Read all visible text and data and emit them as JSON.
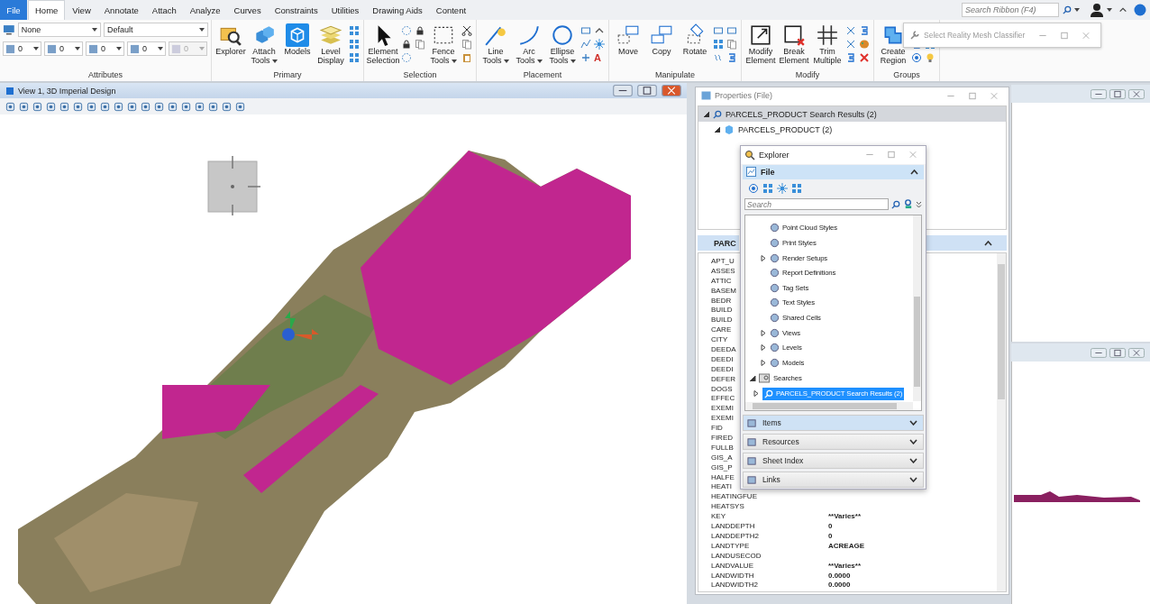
{
  "menu_tabs": [
    {
      "label": "File",
      "kind": "file",
      "selected": false
    },
    {
      "label": "Home",
      "kind": "tab",
      "selected": true
    },
    {
      "label": "View",
      "kind": "tab",
      "selected": false
    },
    {
      "label": "Annotate",
      "kind": "tab",
      "selected": false
    },
    {
      "label": "Attach",
      "kind": "tab",
      "selected": false
    },
    {
      "label": "Analyze",
      "kind": "tab",
      "selected": false
    },
    {
      "label": "Curves",
      "kind": "tab",
      "selected": false
    },
    {
      "label": "Constraints",
      "kind": "tab",
      "selected": false
    },
    {
      "label": "Utilities",
      "kind": "tab",
      "selected": false
    },
    {
      "label": "Drawing Aids",
      "kind": "tab",
      "selected": false
    },
    {
      "label": "Content",
      "kind": "tab",
      "selected": false
    }
  ],
  "ribbon_search": {
    "placeholder": "Search Ribbon (F4)"
  },
  "ribbon_groups": [
    {
      "title": "Attributes",
      "kind": "attributes",
      "dropdowns": [
        {
          "value": "None"
        },
        {
          "value": "Default"
        }
      ],
      "fields": [
        {
          "value": "0",
          "disabled": false
        },
        {
          "value": "0",
          "disabled": false
        },
        {
          "value": "0",
          "disabled": false
        },
        {
          "value": "0",
          "disabled": false
        },
        {
          "value": "0",
          "disabled": true
        }
      ]
    },
    {
      "title": "Primary",
      "kind": "tools",
      "tools": [
        {
          "label": "Explorer",
          "dropdown": false,
          "selected": false
        },
        {
          "label": "Attach Tools",
          "dropdown": true,
          "selected": false
        },
        {
          "label": "Models",
          "dropdown": false,
          "selected": true
        },
        {
          "label": "Level Display",
          "dropdown": false,
          "selected": false
        }
      ]
    },
    {
      "title": "Selection",
      "kind": "tools",
      "tools": [
        {
          "label": "Element Selection",
          "dropdown": false,
          "selected": false
        },
        {
          "label": "Fence Tools",
          "dropdown": true,
          "selected": false
        }
      ]
    },
    {
      "title": "Placement",
      "kind": "tools",
      "tools": [
        {
          "label": "Line Tools",
          "dropdown": true,
          "selected": false
        },
        {
          "label": "Arc Tools",
          "dropdown": true,
          "selected": false
        },
        {
          "label": "Ellipse Tools",
          "dropdown": true,
          "selected": false
        }
      ],
      "glyph": "A"
    },
    {
      "title": "Manipulate",
      "kind": "tools",
      "tools": [
        {
          "label": "Move",
          "dropdown": false,
          "selected": false
        },
        {
          "label": "Copy",
          "dropdown": false,
          "selected": false
        },
        {
          "label": "Rotate",
          "dropdown": false,
          "selected": false
        }
      ]
    },
    {
      "title": "Modify",
      "kind": "tools",
      "tools": [
        {
          "label": "Modify Element",
          "dropdown": false,
          "selected": false
        },
        {
          "label": "Break Element",
          "dropdown": false,
          "selected": false
        },
        {
          "label": "Trim Multiple",
          "dropdown": false,
          "selected": false
        }
      ]
    },
    {
      "title": "Groups",
      "kind": "tools",
      "tools": [
        {
          "label": "Create Region",
          "dropdown": false,
          "selected": false
        }
      ]
    }
  ],
  "floating_dialog": {
    "title": "Select Reality Mesh Classifier"
  },
  "view_window": {
    "title": "View 1, 3D Imperial Design"
  },
  "properties": {
    "title": "Properties (File)",
    "tree": [
      {
        "label": "PARCELS_PRODUCT Search Results (2)",
        "selected": true,
        "expanded": true,
        "children": [
          {
            "label": "PARCELS_PRODUCT (2)",
            "selected": false,
            "expanded": true
          }
        ]
      }
    ],
    "section": {
      "label": "PARC",
      "expanded": true
    },
    "rows": [
      {
        "name": "APT_U"
      },
      {
        "name": "ASSES"
      },
      {
        "name": "ATTIC"
      },
      {
        "name": "BASEM"
      },
      {
        "name": "BEDR"
      },
      {
        "name": "BUILD"
      },
      {
        "name": "BUILD"
      },
      {
        "name": "CARE"
      },
      {
        "name": "CITY"
      },
      {
        "name": "DEEDA"
      },
      {
        "name": "DEEDI"
      },
      {
        "name": "DEEDI"
      },
      {
        "name": "DEFER"
      },
      {
        "name": "DOGS"
      },
      {
        "name": "EFFEC"
      },
      {
        "name": "EXEMI"
      },
      {
        "name": "EXEMI"
      },
      {
        "name": "FID"
      },
      {
        "name": "FIRED"
      },
      {
        "name": "FULLB"
      },
      {
        "name": "GIS_A"
      },
      {
        "name": "GIS_P"
      },
      {
        "name": "HALFE"
      },
      {
        "name": "HEATI"
      },
      {
        "name": "HEATINGFUE"
      },
      {
        "name": "HEATSYS"
      },
      {
        "name": "KEY",
        "value": "**Varies**"
      },
      {
        "name": "LANDDEPTH",
        "value": "0"
      },
      {
        "name": "LANDDEPTH2",
        "value": "0"
      },
      {
        "name": "LANDTYPE",
        "value": "ACREAGE"
      },
      {
        "name": "LANDUSECOD"
      },
      {
        "name": "LANDVALUE",
        "value": "**Varies**"
      },
      {
        "name": "LANDWIDTH",
        "value": "0.0000"
      },
      {
        "name": "LANDWIDTH2",
        "value": "0.0000"
      }
    ]
  },
  "explorer": {
    "title": "Explorer",
    "file_section": {
      "label": "File",
      "expanded": true
    },
    "search": {
      "placeholder": "Search"
    },
    "tree_upper": [
      {
        "label": "Point Cloud Styles"
      },
      {
        "label": "Print Styles"
      },
      {
        "label": "Render Setups",
        "expanded": false
      },
      {
        "label": "Report Definitions"
      },
      {
        "label": "Tag Sets"
      },
      {
        "label": "Text Styles"
      },
      {
        "label": "Shared Cells"
      },
      {
        "label": "Views",
        "expanded": false
      },
      {
        "label": "Levels",
        "expanded": false
      },
      {
        "label": "Models",
        "expanded": false
      }
    ],
    "tree": [
      {
        "label": "Searches",
        "expanded": true,
        "selected": false,
        "children": [
          {
            "label": "PARCELS_PRODUCT Search Results (2)",
            "expanded": false,
            "selected": true
          }
        ]
      }
    ],
    "sections": [
      {
        "label": "Items",
        "highlighted": true
      },
      {
        "label": "Resources",
        "highlighted": false
      },
      {
        "label": "Sheet Index",
        "highlighted": false
      },
      {
        "label": "Links",
        "highlighted": false
      }
    ]
  }
}
